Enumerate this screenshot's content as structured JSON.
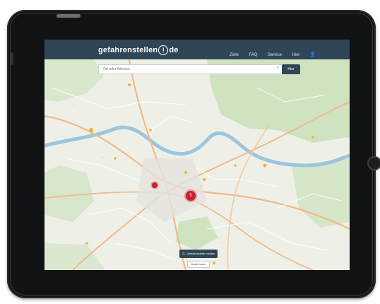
{
  "header": {
    "logo_text_part1": "gefahrenstellen",
    "logo_pin_glyph": "!",
    "logo_text_part2": "de",
    "nav": [
      "Ziele",
      "FAQ",
      "Service",
      "Hier"
    ],
    "nav_icon": "user-icon"
  },
  "search": {
    "placeholder": "Ort oder Adresse",
    "clear_glyph": "×",
    "button_label": "Hier"
  },
  "map": {
    "marker_big_label": "5",
    "colors": {
      "land": "#eef0e8",
      "forest": "#cfe3c0",
      "river": "#9cc5de",
      "major_road": "#f2b98a",
      "road": "#ffffff",
      "header": "#2f4657",
      "marker": "#c9202e"
    }
  },
  "report_button_label": "Gefahrenstelle melden",
  "map_toggle_label": "Karte laden"
}
